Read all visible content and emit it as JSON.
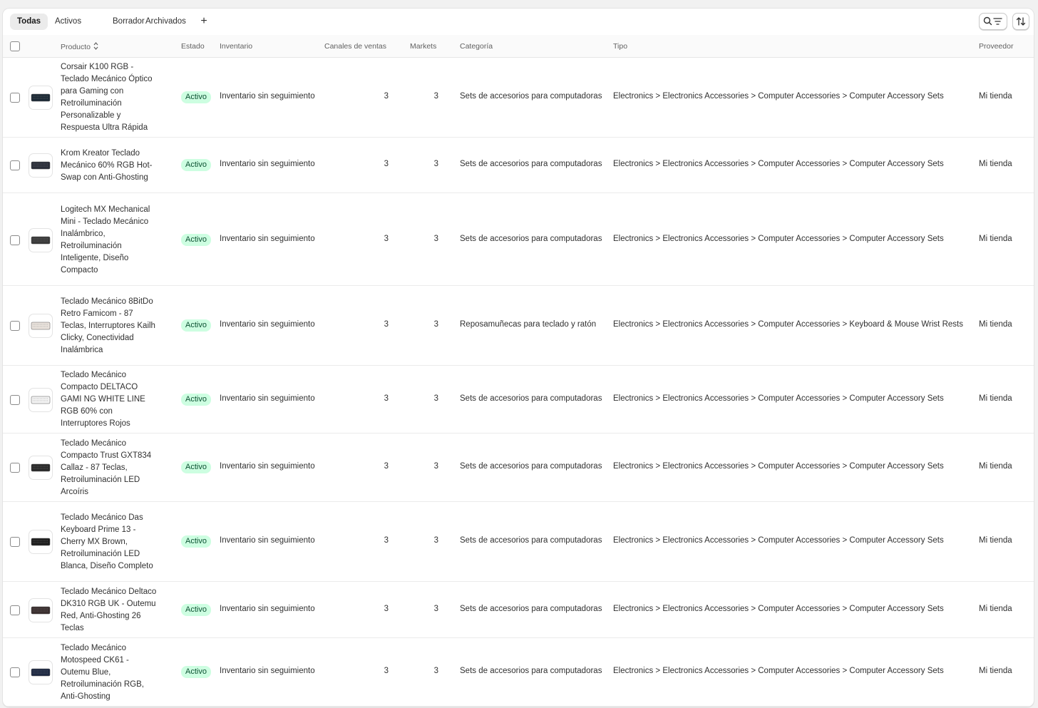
{
  "tabs": [
    {
      "label": "Todas",
      "active": true
    },
    {
      "label": "Activos",
      "active": false
    },
    {
      "label": "Borrador",
      "active": false
    },
    {
      "label": "Archivados",
      "active": false
    }
  ],
  "tab_add_label": "+",
  "toolbar": {
    "search_filter_icons": [
      "search-icon",
      "filter-icon"
    ],
    "sort_icon": "sort-icon"
  },
  "columns": {
    "product": "Producto",
    "status": "Estado",
    "inventory": "Inventario",
    "channels": "Canales de ventas",
    "markets": "Markets",
    "category": "Categoría",
    "type": "Tipo",
    "vendor": "Proveedor"
  },
  "colors": {
    "badge_bg": "#cdfee1",
    "badge_text": "#0c5132",
    "active_tab_bg": "#ebebeb"
  },
  "rows": [
    {
      "name": "Corsair K100 RGB - Teclado Mecánico Óptico para Gaming con Retroiluminación Personalizable y Respuesta Ultra Rápida",
      "status": "Activo",
      "inventory": "Inventario sin seguimiento",
      "channels": "3",
      "markets": "3",
      "category": "Sets de accesorios para computadoras",
      "type": "Electronics > Electronics Accessories > Computer Accessories > Computer Accessory Sets",
      "vendor": "Mi tienda"
    },
    {
      "name": "Krom Kreator Teclado Mecánico 60% RGB Hot-Swap con Anti-Ghosting",
      "status": "Activo",
      "inventory": "Inventario sin seguimiento",
      "channels": "3",
      "markets": "3",
      "category": "Sets de accesorios para computadoras",
      "type": "Electronics > Electronics Accessories > Computer Accessories > Computer Accessory Sets",
      "vendor": "Mi tienda"
    },
    {
      "name": "Logitech MX Mechanical Mini - Teclado Mecánico Inalámbrico, Retroiluminación Inteligente, Diseño Compacto",
      "status": "Activo",
      "inventory": "Inventario sin seguimiento",
      "channels": "3",
      "markets": "3",
      "category": "Sets de accesorios para computadoras",
      "type": "Electronics > Electronics Accessories > Computer Accessories > Computer Accessory Sets",
      "vendor": "Mi tienda"
    },
    {
      "name": "Teclado Mecánico 8BitDo Retro Famicom - 87 Teclas, Interruptores Kailh Clicky, Conectividad Inalámbrica",
      "status": "Activo",
      "inventory": "Inventario sin seguimiento",
      "channels": "3",
      "markets": "3",
      "category": "Reposamuñecas para teclado y ratón",
      "type": "Electronics > Electronics Accessories > Computer Accessories > Keyboard & Mouse Wrist Rests",
      "vendor": "Mi tienda"
    },
    {
      "name": "Teclado Mecánico Compacto DELTACO GAMI NG WHITE LINE RGB 60% con Interruptores Rojos",
      "status": "Activo",
      "inventory": "Inventario sin seguimiento",
      "channels": "3",
      "markets": "3",
      "category": "Sets de accesorios para computadoras",
      "type": "Electronics > Electronics Accessories > Computer Accessories > Computer Accessory Sets",
      "vendor": "Mi tienda"
    },
    {
      "name": "Teclado Mecánico Compacto Trust GXT834 Callaz - 87 Teclas, Retroiluminación LED Arcoíris",
      "status": "Activo",
      "inventory": "Inventario sin seguimiento",
      "channels": "3",
      "markets": "3",
      "category": "Sets de accesorios para computadoras",
      "type": "Electronics > Electronics Accessories > Computer Accessories > Computer Accessory Sets",
      "vendor": "Mi tienda"
    },
    {
      "name": "Teclado Mecánico Das Keyboard Prime 13 - Cherry MX Brown, Retroiluminación LED Blanca, Diseño Completo",
      "status": "Activo",
      "inventory": "Inventario sin seguimiento",
      "channels": "3",
      "markets": "3",
      "category": "Sets de accesorios para computadoras",
      "type": "Electronics > Electronics Accessories > Computer Accessories > Computer Accessory Sets",
      "vendor": "Mi tienda"
    },
    {
      "name": "Teclado Mecánico Deltaco DK310 RGB UK - Outemu Red, Anti-Ghosting 26 Teclas",
      "status": "Activo",
      "inventory": "Inventario sin seguimiento",
      "channels": "3",
      "markets": "3",
      "category": "Sets de accesorios para computadoras",
      "type": "Electronics > Electronics Accessories > Computer Accessories > Computer Accessory Sets",
      "vendor": "Mi tienda"
    },
    {
      "name": "Teclado Mecánico Motospeed CK61 - Outemu Blue, Retroiluminación RGB, Anti-Ghosting",
      "status": "Activo",
      "inventory": "Inventario sin seguimiento",
      "channels": "3",
      "markets": "3",
      "category": "Sets de accesorios para computadoras",
      "type": "Electronics > Electronics Accessories > Computer Accessories > Computer Accessory Sets",
      "vendor": "Mi tienda"
    }
  ]
}
